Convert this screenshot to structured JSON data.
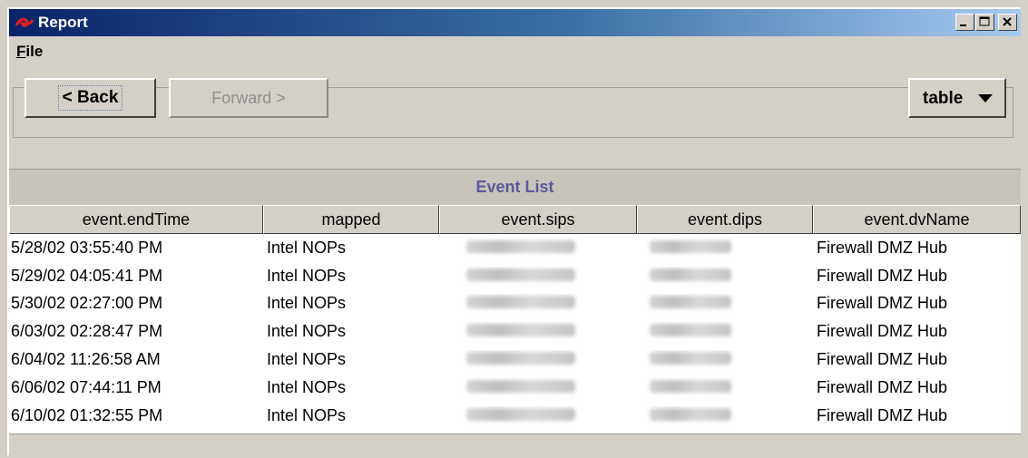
{
  "window": {
    "title": "Report",
    "minimize_icon": "minimize-icon",
    "maximize_icon": "maximize-icon",
    "close_icon": "close-icon",
    "app_icon": "swirl-logo-icon"
  },
  "menu": {
    "file_mnemonic": "F",
    "file_rest": "ile"
  },
  "toolbar": {
    "back_label": "< Back",
    "forward_label": "Forward >",
    "view_value": "table"
  },
  "list": {
    "title": "Event List",
    "columns": [
      "event.endTime",
      "mapped",
      "event.sips",
      "event.dips",
      "event.dvName"
    ],
    "rows": [
      {
        "endTime": "5/28/02 03:55:40 PM",
        "mapped": "Intel NOPs",
        "dvName": "Firewall DMZ Hub"
      },
      {
        "endTime": "5/29/02 04:05:41 PM",
        "mapped": "Intel NOPs",
        "dvName": "Firewall DMZ Hub"
      },
      {
        "endTime": "5/30/02 02:27:00 PM",
        "mapped": "Intel NOPs",
        "dvName": "Firewall DMZ Hub"
      },
      {
        "endTime": "6/03/02 02:28:47 PM",
        "mapped": "Intel NOPs",
        "dvName": "Firewall DMZ Hub"
      },
      {
        "endTime": "6/04/02 11:26:58 AM",
        "mapped": "Intel NOPs",
        "dvName": "Firewall DMZ Hub"
      },
      {
        "endTime": "6/06/02 07:44:11 PM",
        "mapped": "Intel NOPs",
        "dvName": "Firewall DMZ Hub"
      },
      {
        "endTime": "6/10/02 01:32:55 PM",
        "mapped": "Intel NOPs",
        "dvName": "Firewall DMZ Hub"
      }
    ]
  },
  "colors": {
    "titlebar_start": "#0a246a",
    "titlebar_end": "#a6caf0",
    "list_title": "#5a5a9a"
  }
}
